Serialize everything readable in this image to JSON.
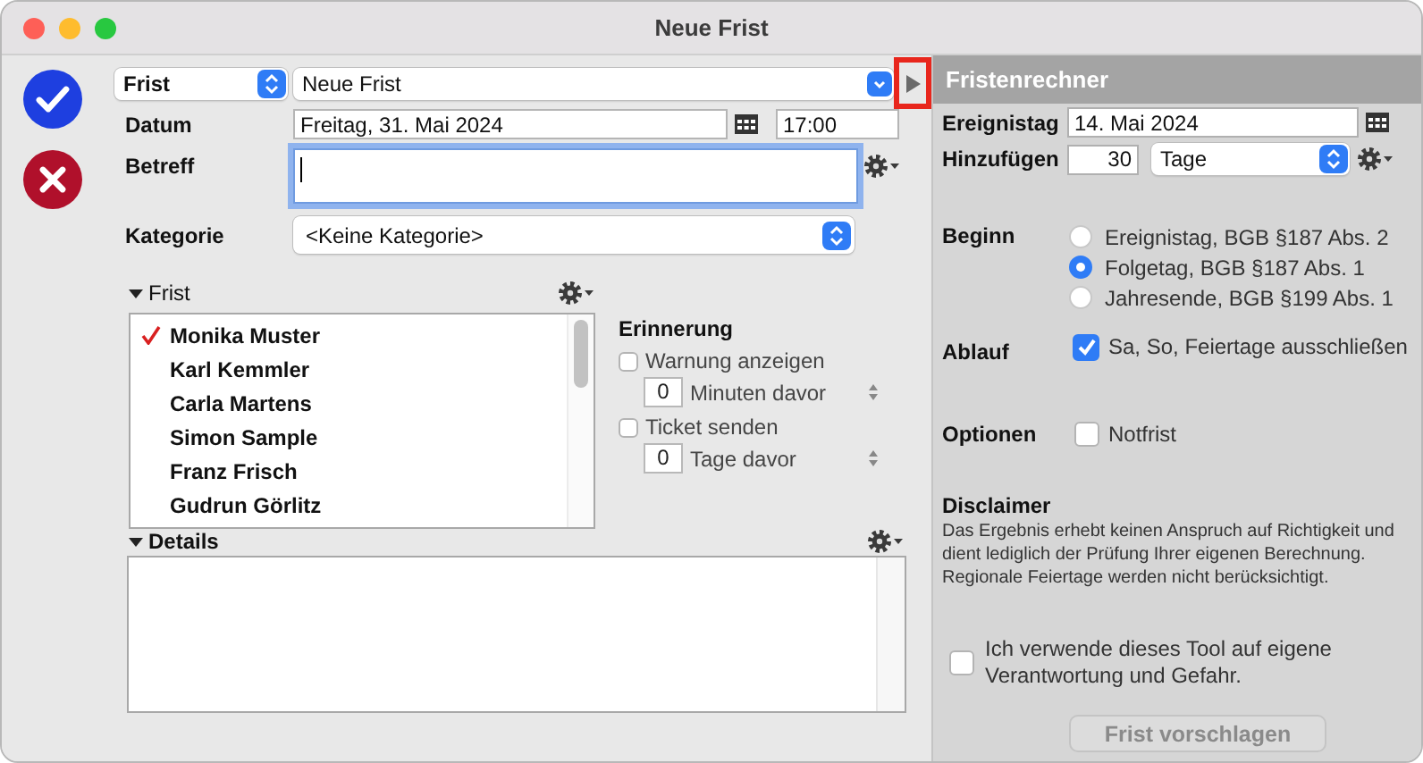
{
  "window": {
    "title": "Neue Frist"
  },
  "type_popup": {
    "value": "Frist"
  },
  "title_combo": {
    "value": "Neue Frist"
  },
  "panel_toggle": {
    "highlighted": true
  },
  "date": {
    "label": "Datum",
    "value": "Freitag, 31. Mai 2024",
    "time": "17:00"
  },
  "subject": {
    "label": "Betreff",
    "focused": true
  },
  "category": {
    "label": "Kategorie",
    "value": "<Keine Kategorie>"
  },
  "frist_section": {
    "title": "Frist",
    "expanded": true,
    "people": [
      {
        "name": "Monika Muster",
        "checked": true
      },
      {
        "name": "Karl Kemmler",
        "checked": false
      },
      {
        "name": "Carla Martens",
        "checked": false
      },
      {
        "name": "Simon Sample",
        "checked": false
      },
      {
        "name": "Franz Frisch",
        "checked": false
      },
      {
        "name": "Gudrun Görlitz",
        "checked": false
      }
    ]
  },
  "reminder": {
    "title": "Erinnerung",
    "options": [
      {
        "label": "Warnung anzeigen",
        "checked": false,
        "amount": "0",
        "unit": "Minuten davor"
      },
      {
        "label": "Ticket senden",
        "checked": false,
        "amount": "0",
        "unit": "Tage davor"
      }
    ]
  },
  "details": {
    "title": "Details",
    "expanded": true
  },
  "calculator": {
    "title": "Fristenrechner",
    "event_day": {
      "label": "Ereignistag",
      "value": "14. Mai 2024"
    },
    "add": {
      "label": "Hinzufügen",
      "amount": "30",
      "unit": "Tage"
    },
    "start": {
      "label": "Beginn",
      "options": [
        {
          "label": "Ereignistag, BGB §187 Abs. 2",
          "selected": false
        },
        {
          "label": "Folgetag, BGB §187 Abs. 1",
          "selected": true
        },
        {
          "label": "Jahresende, BGB §199 Abs. 1",
          "selected": false
        }
      ]
    },
    "end": {
      "label": "Ablauf",
      "option": {
        "label": "Sa, So, Feiertage ausschließen",
        "checked": true
      }
    },
    "options": {
      "label": "Optionen",
      "option": {
        "label": "Notfrist",
        "checked": false
      }
    },
    "disclaimer": {
      "title": "Disclaimer",
      "text": "Das Ergebnis erhebt keinen Anspruch auf Richtigkeit und dient lediglich der Prüfung Ihrer eigenen Berechnung. Regionale Feiertage werden nicht berücksichtigt."
    },
    "consent": {
      "label": "Ich verwende dieses Tool auf eigene Verantwortung und Gefahr.",
      "checked": false
    },
    "submit": {
      "label": "Frist vorschlagen",
      "disabled": true
    }
  }
}
